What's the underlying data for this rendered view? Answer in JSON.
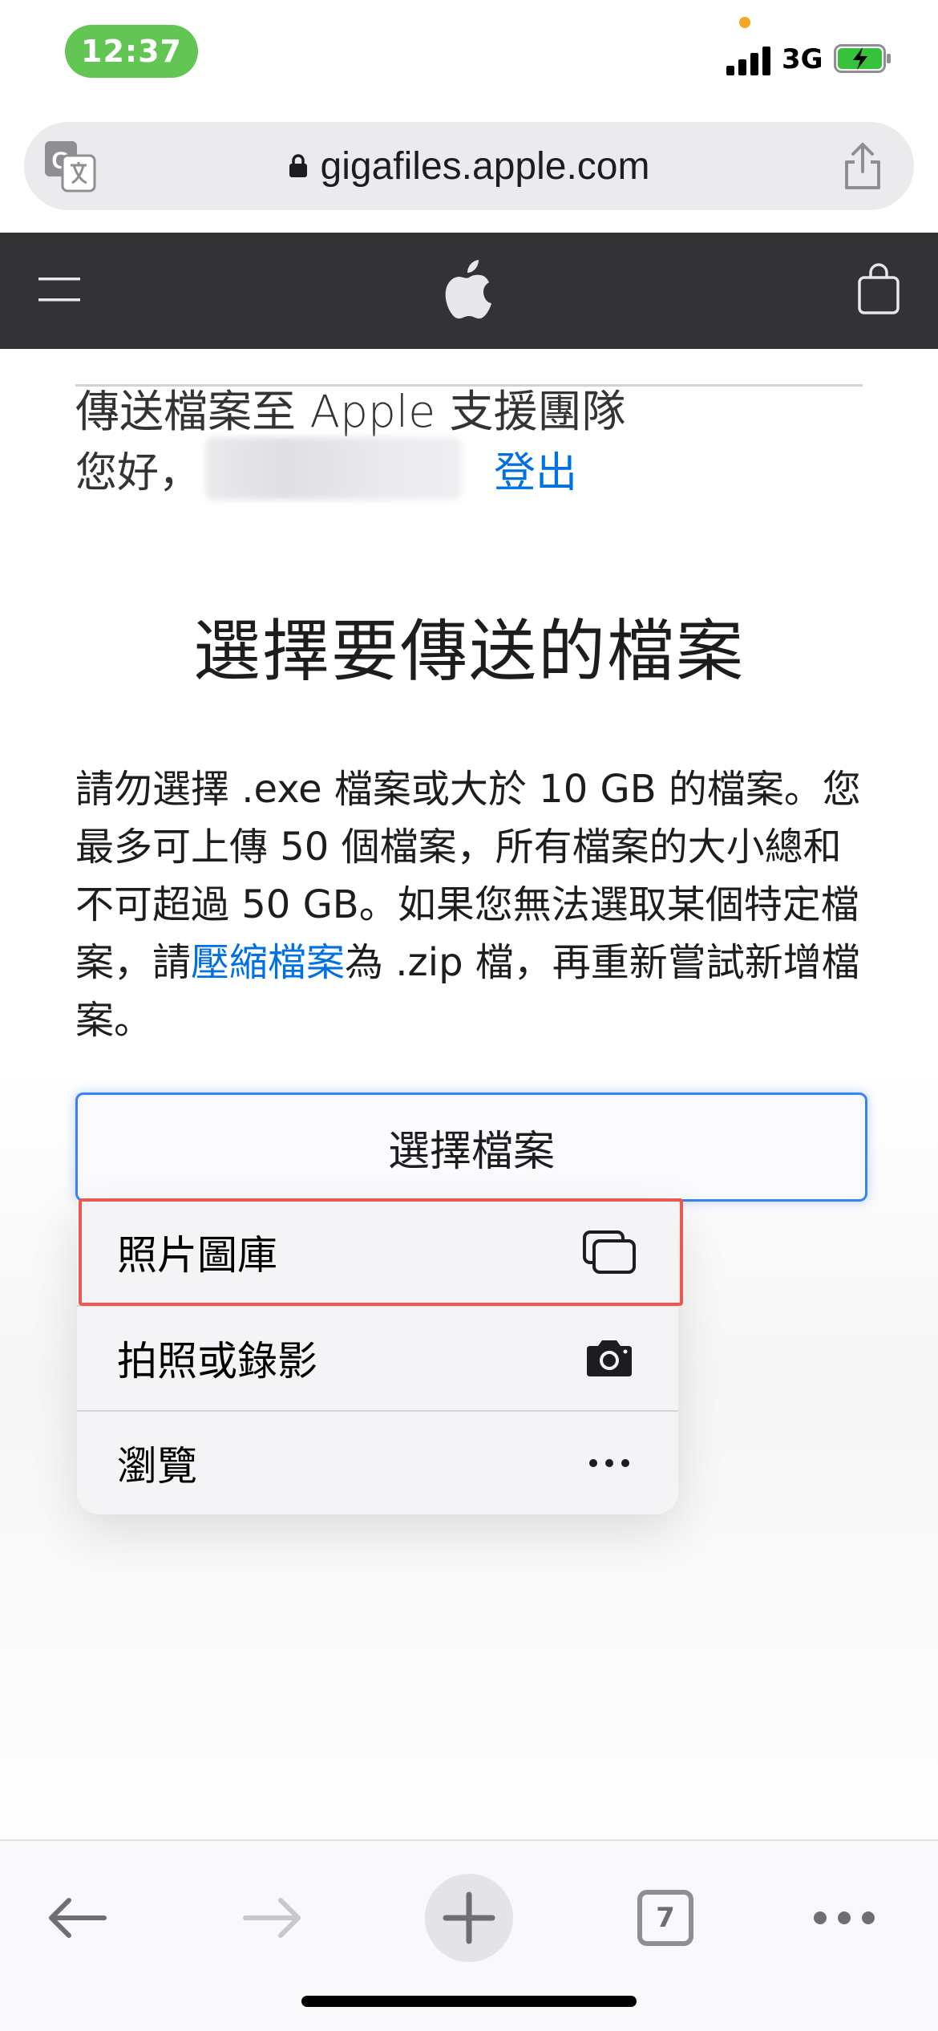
{
  "status_bar": {
    "time": "12:37",
    "network": "3G",
    "icons": [
      "signal-icon",
      "battery-charging-icon"
    ]
  },
  "browser": {
    "url": "gigafiles.apple.com",
    "icons": [
      "translate-icon",
      "lock-icon",
      "share-icon"
    ]
  },
  "site_nav": {
    "icons": [
      "menu-icon",
      "apple-logo",
      "bag-icon"
    ],
    "bar_color": "#333336"
  },
  "page": {
    "header": "傳送檔案至 Apple 支援團隊",
    "greeting": "您好，",
    "logout": "登出",
    "title": "選擇要傳送的檔案",
    "description_before_link": "請勿選擇 .exe 檔案或大於 10 GB 的檔案。您最多可上傳 50 個檔案，所有檔案的大小總和不可超過 50 GB。如果您無法選取某個特定檔案，請",
    "description_link": "壓縮檔案",
    "description_after_link": "為 .zip 檔，再重新嘗試新增檔案。",
    "choose_button": "選擇檔案",
    "link_color": "#0071e3"
  },
  "file_picker": {
    "items": [
      {
        "label": "照片圖庫",
        "icon": "photo-library-icon"
      },
      {
        "label": "拍照或錄影",
        "icon": "camera-icon"
      },
      {
        "label": "瀏覽",
        "icon": "more-icon"
      }
    ],
    "highlight_color": "#e85a4f"
  },
  "toolbar": {
    "tab_count": "7",
    "icons": [
      "back-arrow-icon",
      "forward-arrow-icon",
      "new-tab-icon",
      "tabs-icon",
      "more-menu-icon"
    ]
  }
}
